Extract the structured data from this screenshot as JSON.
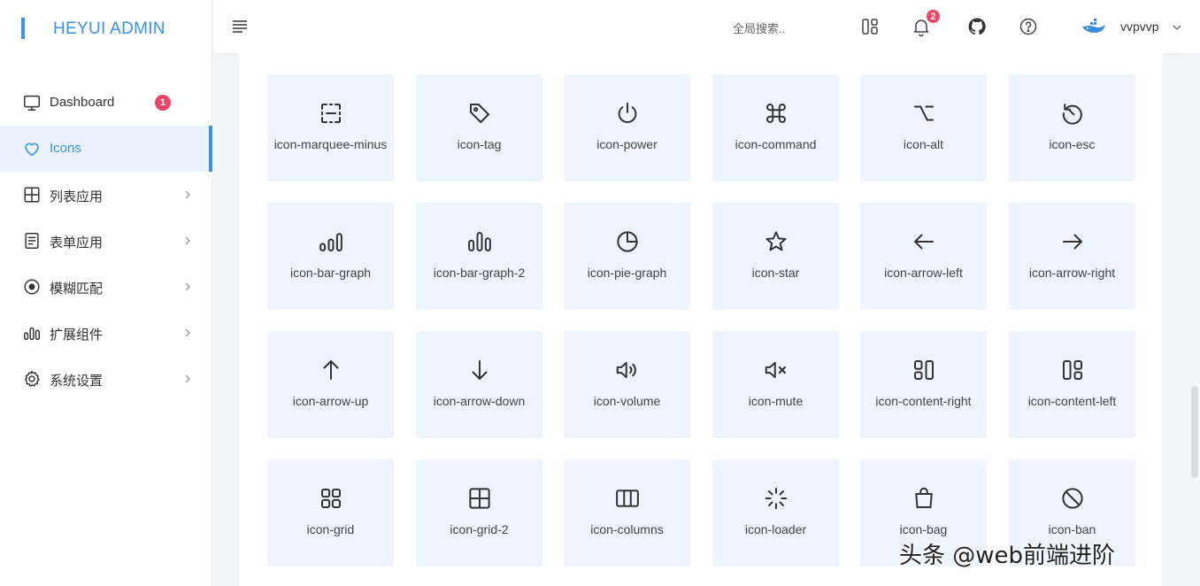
{
  "app": {
    "title": "HEYUI ADMIN",
    "accent": "#3a91ea",
    "badge_color": "#ef4565"
  },
  "sidebar": {
    "items": [
      {
        "label": "Dashboard",
        "icon": "monitor-icon",
        "badge": "1",
        "active": false
      },
      {
        "label": "Icons",
        "icon": "heart-icon",
        "active": true
      },
      {
        "label": "列表应用",
        "icon": "grid-icon",
        "active": false
      },
      {
        "label": "表单应用",
        "icon": "document-icon",
        "active": false
      },
      {
        "label": "模糊匹配",
        "icon": "target-icon",
        "active": false
      },
      {
        "label": "扩展组件",
        "icon": "bar-graph-icon",
        "active": false
      },
      {
        "label": "系统设置",
        "icon": "gear-icon",
        "active": false
      }
    ]
  },
  "header": {
    "search_placeholder": "全局搜索..",
    "notifications_count": "2",
    "username": "vvpvvp"
  },
  "icons": [
    "icon-marquee-minus",
    "icon-tag",
    "icon-power",
    "icon-command",
    "icon-alt",
    "icon-esc",
    "icon-bar-graph",
    "icon-bar-graph-2",
    "icon-pie-graph",
    "icon-star",
    "icon-arrow-left",
    "icon-arrow-right",
    "icon-arrow-up",
    "icon-arrow-down",
    "icon-volume",
    "icon-mute",
    "icon-content-right",
    "icon-content-left",
    "icon-grid",
    "icon-grid-2",
    "icon-columns",
    "icon-loader",
    "icon-bag",
    "icon-ban"
  ],
  "watermark": "头条 @web前端进阶"
}
